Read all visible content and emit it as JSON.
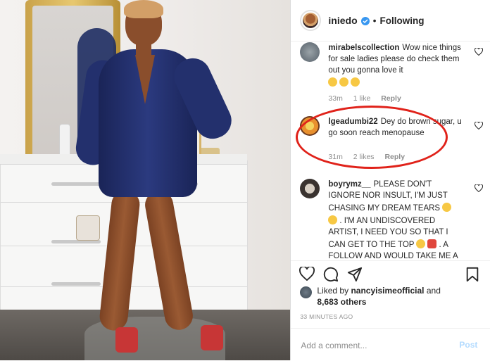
{
  "header": {
    "username": "iniedo",
    "separator": "•",
    "follow_status": "Following"
  },
  "comments": [
    {
      "username": "mirabelscollection",
      "text": "Wow nice things for sale ladies please do check them out you gonna love it",
      "emojis": [
        "face-emoji",
        "face-emoji",
        "face-emoji"
      ],
      "time": "33m",
      "likes": "1 like",
      "reply": "Reply"
    },
    {
      "username": "lgeadumbi22",
      "text": "Dey do brown sugar, u go soon reach menopause",
      "time": "31m",
      "likes": "2 likes",
      "reply": "Reply"
    },
    {
      "username": "boyrymz__",
      "text": "PLEASE DON'T IGNORE NOR INSULT, I'M JUST CHASING MY DREAM TEARS",
      "text2": ". I'M AN UNDISCOVERED ARTIST, I NEED YOU SO THAT I CAN GET TO THE TOP",
      "text3": ". A FOLLOW AND WOULD TAKE ME A"
    }
  ],
  "likes": {
    "prefix": "Liked by",
    "user": "nancyisimeofficial",
    "and": "and",
    "count": "8,683 others"
  },
  "timestamp": "33 MINUTES AGO",
  "add_comment": {
    "placeholder": "Add a comment...",
    "post_label": "Post"
  },
  "colors": {
    "verified": "#3897f0",
    "highlight_circle": "#e0221a",
    "post_disabled": "#b3dbff"
  }
}
